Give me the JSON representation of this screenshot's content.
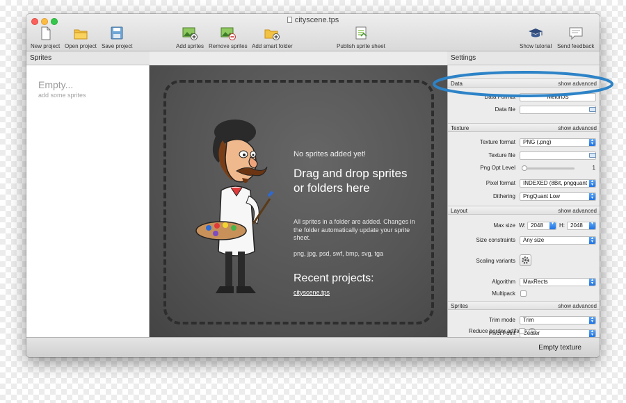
{
  "window": {
    "title": "cityscene.tps"
  },
  "toolbar": {
    "new_project": "New project",
    "open_project": "Open project",
    "save_project": "Save project",
    "add_sprites": "Add sprites",
    "remove_sprites": "Remove sprites",
    "add_smart_folder": "Add smart folder",
    "publish_sprite_sheet": "Publish sprite sheet",
    "show_tutorial": "Show tutorial",
    "send_feedback": "Send feedback"
  },
  "sprites_panel": {
    "header": "Sprites",
    "empty_title": "Empty...",
    "empty_subtitle": "add some sprites"
  },
  "center": {
    "no_sprites": "No sprites added yet!",
    "drag_drop": "Drag and drop sprites or folders here",
    "description": "All sprites in a folder are added. Changes in the folder automatically update your sprite sheet.",
    "formats": "png, jpg, psd, swf, bmp, svg, tga",
    "recent_title": "Recent projects:",
    "recent_file": "cityscene.tps"
  },
  "settings": {
    "header": "Settings",
    "data": {
      "title": "Data",
      "show_advanced": "show advanced",
      "data_format_label": "Data Format",
      "data_format_value": "MelonJS",
      "data_file_label": "Data file",
      "data_file_value": ""
    },
    "texture": {
      "title": "Texture",
      "show_advanced": "show advanced",
      "texture_format_label": "Texture format",
      "texture_format_value": "PNG (.png)",
      "texture_file_label": "Texture file",
      "texture_file_value": "",
      "png_opt_label": "Png Opt Level",
      "png_opt_value": "1",
      "png_opt_level_fraction": 0.05,
      "pixel_format_label": "Pixel format",
      "pixel_format_value": "INDEXED (8Bit, pngquant",
      "dithering_label": "Dithering",
      "dithering_value": "PngQuant Low"
    },
    "layout": {
      "title": "Layout",
      "show_advanced": "show advanced",
      "max_size_label": "Max size",
      "w_label": "W:",
      "w_value": "2048",
      "h_label": "H:",
      "h_value": "2048",
      "size_constraints_label": "Size constraints",
      "size_constraints_value": "Any size",
      "scaling_variants_label": "Scaling variants",
      "algorithm_label": "Algorithm",
      "algorithm_value": "MaxRects",
      "multipack_label": "Multipack"
    },
    "sprites": {
      "title": "Sprites",
      "show_advanced": "show advanced",
      "trim_mode_label": "Trim mode",
      "trim_mode_value": "Trim",
      "pivot_point_label": "Pivot Point",
      "pivot_point_value": "Center",
      "reduce_border_label": "Reduce border artifacts",
      "info_glyph": "i"
    }
  },
  "status_bar": {
    "text": "Empty texture"
  },
  "icons": {
    "new_project": "document-icon",
    "open_project": "folder-icon",
    "save_project": "floppy-disk-icon",
    "add_sprites": "image-plus-icon",
    "remove_sprites": "image-minus-icon",
    "add_smart_folder": "smart-folder-icon",
    "publish": "publish-icon",
    "tutorial": "graduation-cap-icon",
    "feedback": "speech-bubble-icon",
    "gear": "gear-icon",
    "info": "info-icon",
    "folder_small": "folder-icon"
  },
  "colors": {
    "accent_blue": "#1f73e2",
    "annotation_ring": "#2d83c7",
    "canvas_gray": "#555555",
    "traffic_close": "#fc605c",
    "traffic_min": "#fdbc40",
    "traffic_max": "#34c84a"
  }
}
